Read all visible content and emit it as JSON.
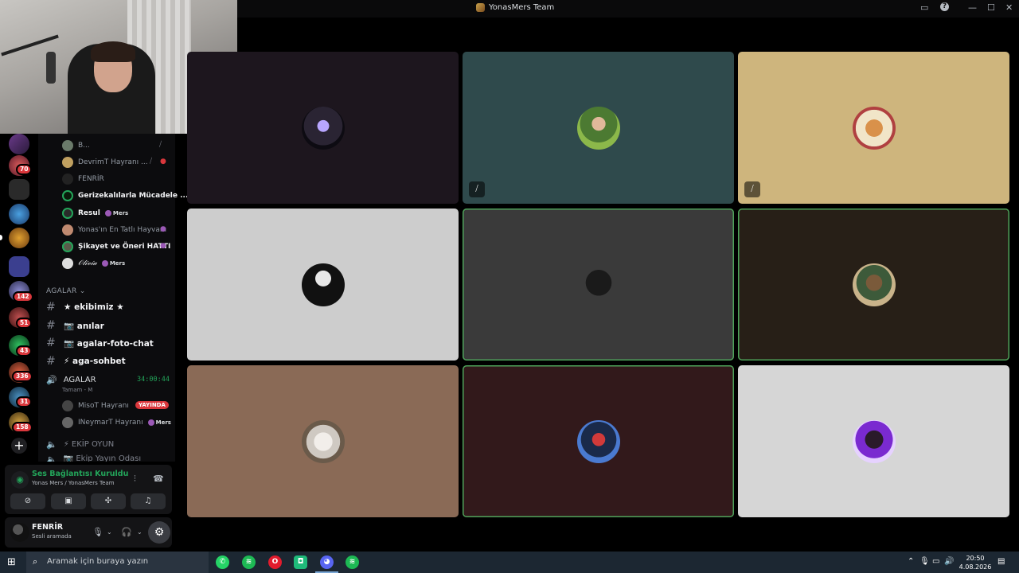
{
  "window": {
    "title": "YonasMers Team",
    "controls": {
      "screen_share": "▭",
      "help": "?",
      "minimize": "—",
      "maximize": "☐",
      "close": "✕"
    }
  },
  "server_rail": {
    "badges": [
      "70",
      "142",
      "51",
      "43",
      "336",
      "31",
      "158"
    ],
    "add_server": "+"
  },
  "sidebar": {
    "voice_users_top": [
      {
        "name": "B...",
        "tag": "",
        "muted": true
      },
      {
        "name": "DevrimT Hayranı ...",
        "tag": "",
        "muted": true
      },
      {
        "name": "FENRİR",
        "tag": "",
        "muted": false
      },
      {
        "name": "Gerizekalılarla Mücadele ...",
        "tag": "",
        "muted": false
      },
      {
        "name": "Resul",
        "tag": "Mers",
        "muted": false
      },
      {
        "name": "Yonas'ın En Tatlı Hayvanı",
        "tag": "",
        "muted": false
      },
      {
        "name": "Şikayet ve Öneri HATTI",
        "tag": "",
        "muted": false
      },
      {
        "name": "𝒪𝓁𝒾𝓋𝒾𝒶",
        "tag": "Mers",
        "muted": false
      }
    ],
    "category": "AGALAR",
    "text_channels": [
      {
        "name": "★ ekibimiz ★"
      },
      {
        "name": "📷 anılar"
      },
      {
        "name": "📷 agalar-foto-chat"
      },
      {
        "name": "⚡ aga-sohbet"
      }
    ],
    "voice_channel": {
      "name": "AGALAR",
      "timer": "34:00:44",
      "status": "Tamam - M",
      "members": [
        {
          "name": "MisoT Hayranı",
          "badge": "YAYINDA",
          "tag": ""
        },
        {
          "name": "INeymarT Hayranı",
          "badge": "",
          "tag": "Mers"
        }
      ]
    },
    "other_voice_channels": [
      {
        "name": "⚡ EKİP OYUN"
      },
      {
        "name": "📷 Ekip Yayın Odası"
      }
    ]
  },
  "voice_panel": {
    "title": "Ses Bağlantısı Kuruldu",
    "subtitle": "Yonas Mers / YonasMers Team"
  },
  "user_panel": {
    "username": "FENRİR",
    "status": "Sesli aramada"
  },
  "stage": {
    "tiles": [
      {
        "bg": "#1d161e",
        "avatar": "radial-gradient(circle at 50% 45%, #b8a6ff 0 18%, #2a2433 19% 60%, #0d0b12 61%)",
        "muted": false,
        "speaking": false
      },
      {
        "bg": "#2f4a4c",
        "avatar": "radial-gradient(circle at 50% 40%, #e0b89a 0 20%, #4c7a32 21% 55%, #8cb84a 56%)",
        "muted": true,
        "speaking": false
      },
      {
        "bg": "#ceb57d",
        "avatar": "radial-gradient(circle at 50% 50%, #d9914a 0 28%, #f1e5c8 29% 60%, #b04040 61%)",
        "muted": true,
        "speaking": false
      },
      {
        "bg": "#cdcdcd",
        "avatar": "radial-gradient(circle at 50% 35%, #e8e8e8 0 22%, #111 23%)",
        "muted": false,
        "speaking": false
      },
      {
        "bg": "#3a3a3a",
        "avatar": "radial-gradient(circle at 50% 45%, #1a1a1a 0 40%, #3a3a3a 41%)",
        "muted": false,
        "speaking": true
      },
      {
        "bg": "#271f17",
        "avatar": "radial-gradient(circle at 50% 45%, #7a5a3a 0 25%, #3d5a3a 26% 55%, #c9b38a 56%)",
        "muted": false,
        "speaking": true
      },
      {
        "bg": "#8a6a56",
        "avatar": "radial-gradient(circle at 50% 50%, #f2eeea 0 30%, #cfc9c2 31% 55%, #6a5a4a 56%)",
        "muted": false,
        "speaking": false
      },
      {
        "bg": "#32191b",
        "avatar": "radial-gradient(circle at 50% 45%, #d13a3a 0 20%, #1a2a4a 21% 55%, #4a7ad0 56%)",
        "muted": false,
        "speaking": true
      },
      {
        "bg": "#d6d6d6",
        "avatar": "radial-gradient(circle at 50% 45%, #2a1a2a 0 28%, #7a2ad0 29% 58%, #e6d2ff 59%)",
        "muted": false,
        "speaking": false
      }
    ]
  },
  "taskbar": {
    "search_placeholder": "Aramak için buraya yazın",
    "time": "20:50",
    "date": "4.08.2026"
  },
  "colors": {
    "accent_green": "#23a55a",
    "badge_red": "#da373c",
    "blurple": "#5865f2"
  }
}
